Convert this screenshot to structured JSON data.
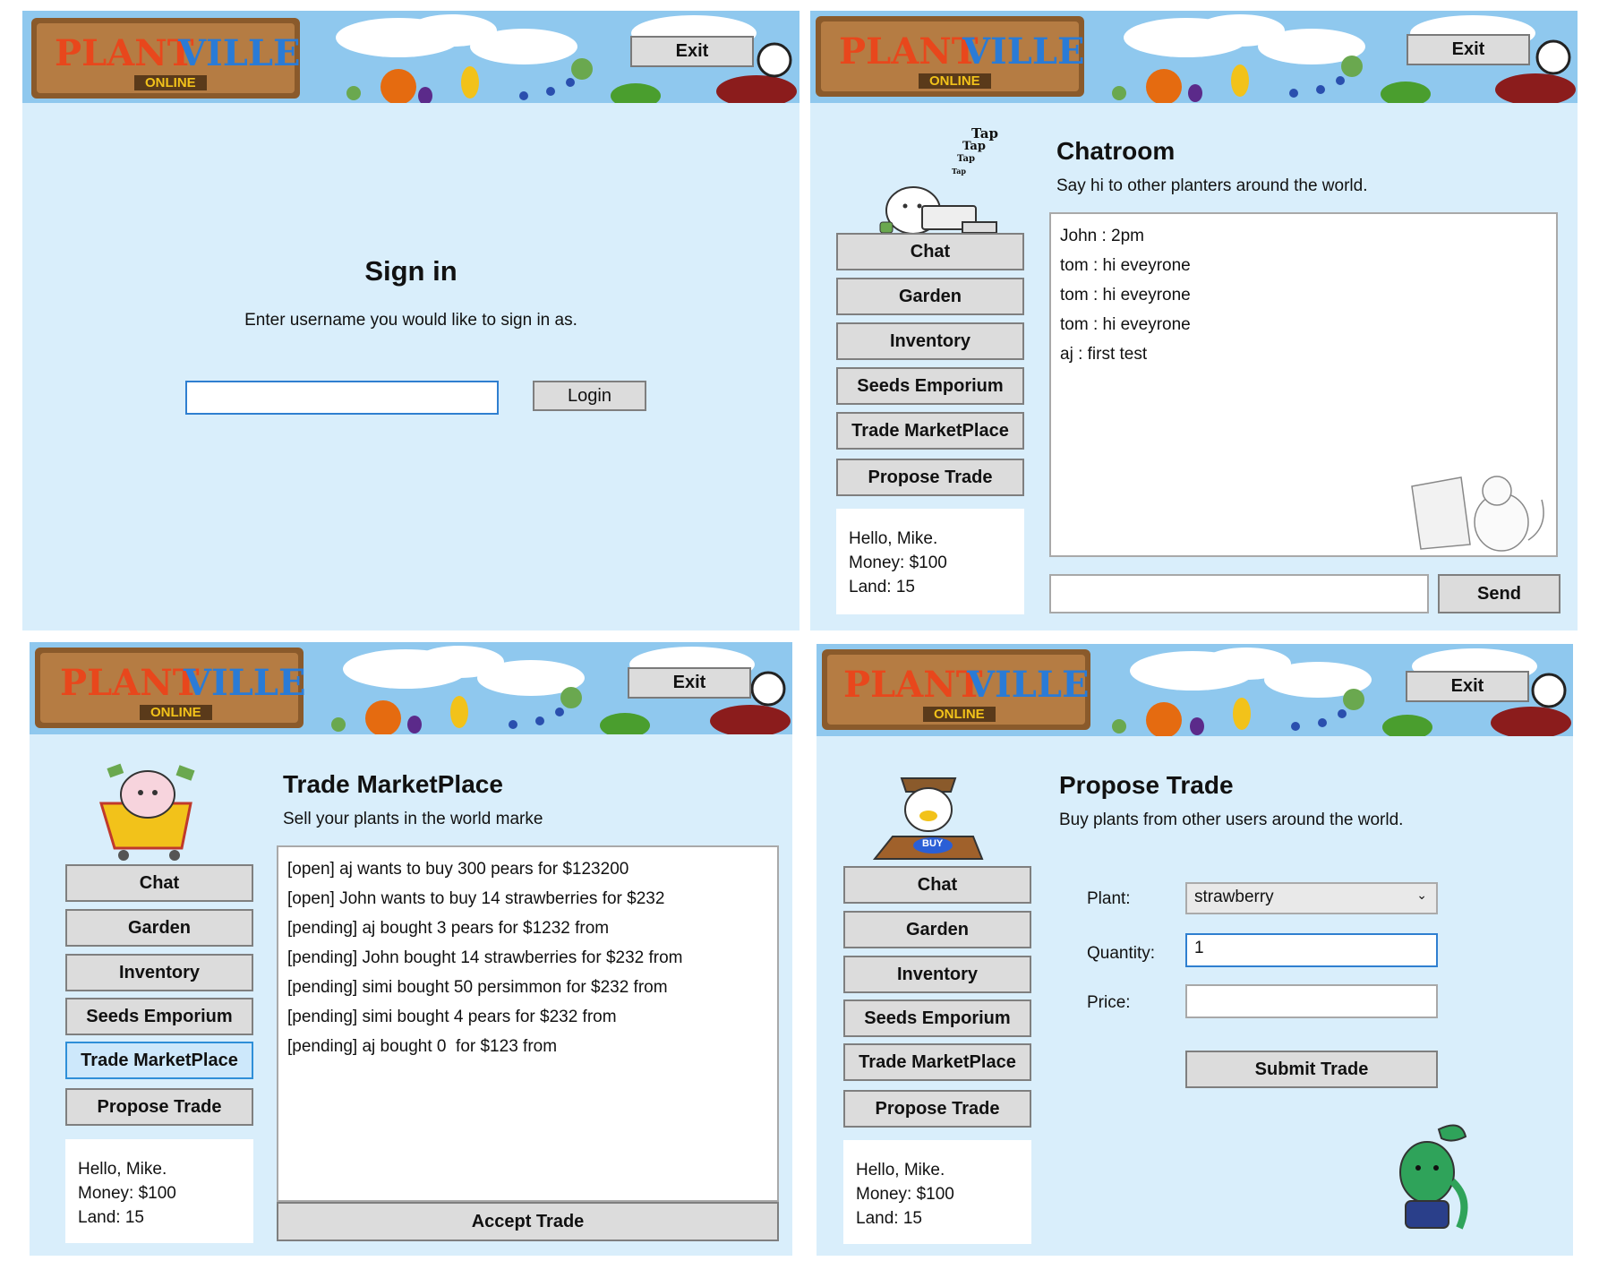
{
  "brand": {
    "logo_word1": "PLANT",
    "logo_word2": "VILLE",
    "logo_tag": "ONLINE",
    "exit_label": "Exit"
  },
  "nav": [
    "Chat",
    "Garden",
    "Inventory",
    "Seeds Emporium",
    "Trade MarketPlace",
    "Propose Trade"
  ],
  "user": {
    "hello": "Hello, Mike.",
    "money": "Money: $100",
    "land": "Land: 15"
  },
  "signin": {
    "title": "Sign in",
    "subtitle": "Enter username you would like to sign in as.",
    "username_value": "",
    "login_label": "Login"
  },
  "chat": {
    "title": "Chatroom",
    "subtitle": "Say hi to other planters around the world.",
    "messages": [
      "John : 2pm",
      "tom : hi eveyrone",
      "tom : hi eveyrone",
      "tom : hi eveyrone",
      "aj : first test"
    ],
    "tap_text": "Tap",
    "input_value": "",
    "send_label": "Send"
  },
  "market": {
    "title": "Trade MarketPlace",
    "subtitle": "Sell your plants in the world marke",
    "trades": [
      "[open] aj wants to buy 300 pears for $123200",
      "[open] John wants to buy 14 strawberries for $232",
      "[pending] aj bought 3 pears for $1232 from",
      "[pending] John bought 14 strawberries for $232 from",
      "[pending] simi bought 50 persimmon for $232 from",
      "[pending] simi bought 4 pears for $232 from",
      "[pending] aj bought 0  for $123 from"
    ],
    "accept_label": "Accept Trade",
    "active_nav": "Trade MarketPlace"
  },
  "propose": {
    "title": "Propose Trade",
    "subtitle": "Buy plants from other users around the world.",
    "plant_label": "Plant:",
    "plant_value": "strawberry",
    "quantity_label": "Quantity:",
    "quantity_value": "1",
    "price_label": "Price:",
    "price_value": "",
    "submit_label": "Submit Trade",
    "buy_sign": "BUY"
  },
  "colors": {
    "panel_bg": "#d9eefb",
    "sky": "#8fc8ee",
    "logo_orange": "#e8471c",
    "logo_blue": "#2a7bd6",
    "focus": "#2f7fd0"
  }
}
